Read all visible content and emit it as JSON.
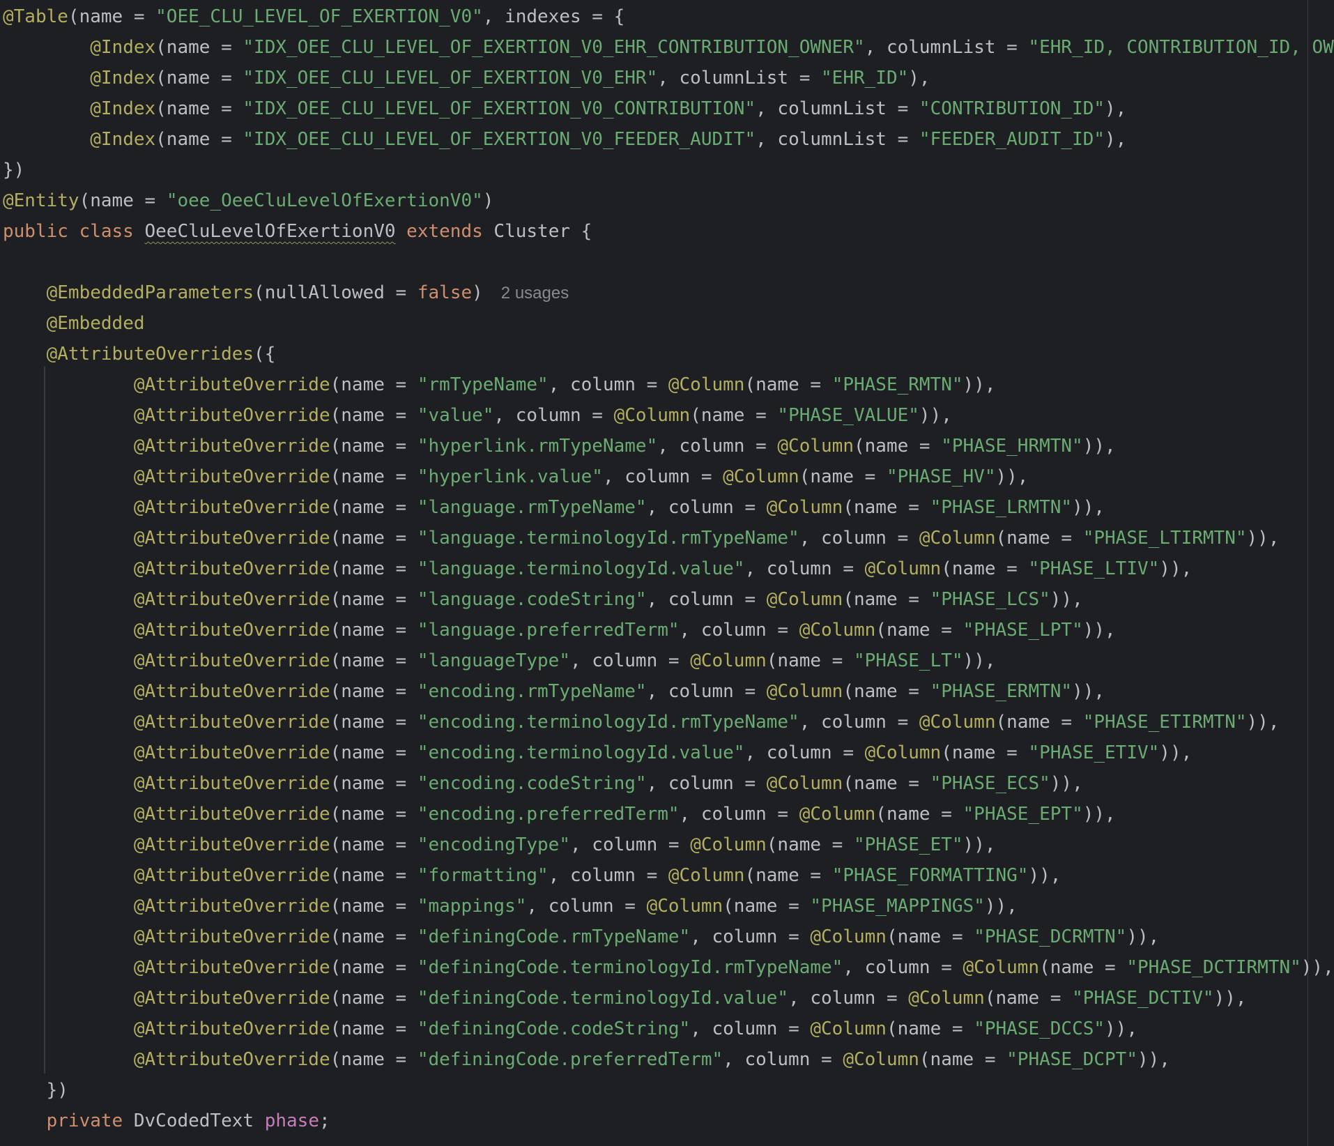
{
  "editor": {
    "language": "java",
    "colors": {
      "background": "#1e1f22",
      "plain": "#bcbec4",
      "annotation": "#b3ae60",
      "string": "#6aab73",
      "keyword": "#cf8e6d",
      "field": "#c77dbb",
      "inlay_hint": "#868a91"
    },
    "lines": [
      [
        [
          "ann",
          "@Table"
        ],
        [
          "p",
          "(name = "
        ],
        [
          "str",
          "\"OEE_CLU_LEVEL_OF_EXERTION_V0\""
        ],
        [
          "p",
          ", indexes = {"
        ]
      ],
      [
        [
          "p",
          "        "
        ],
        [
          "ann",
          "@Index"
        ],
        [
          "p",
          "(name = "
        ],
        [
          "str",
          "\"IDX_OEE_CLU_LEVEL_OF_EXERTION_V0_EHR_CONTRIBUTION_OWNER\""
        ],
        [
          "p",
          ", columnList = "
        ],
        [
          "str",
          "\"EHR_ID, CONTRIBUTION_ID, OWN"
        ]
      ],
      [
        [
          "p",
          "        "
        ],
        [
          "ann",
          "@Index"
        ],
        [
          "p",
          "(name = "
        ],
        [
          "str",
          "\"IDX_OEE_CLU_LEVEL_OF_EXERTION_V0_EHR\""
        ],
        [
          "p",
          ", columnList = "
        ],
        [
          "str",
          "\"EHR_ID\""
        ],
        [
          "p",
          "),"
        ]
      ],
      [
        [
          "p",
          "        "
        ],
        [
          "ann",
          "@Index"
        ],
        [
          "p",
          "(name = "
        ],
        [
          "str",
          "\"IDX_OEE_CLU_LEVEL_OF_EXERTION_V0_CONTRIBUTION\""
        ],
        [
          "p",
          ", columnList = "
        ],
        [
          "str",
          "\"CONTRIBUTION_ID\""
        ],
        [
          "p",
          "),"
        ]
      ],
      [
        [
          "p",
          "        "
        ],
        [
          "ann",
          "@Index"
        ],
        [
          "p",
          "(name = "
        ],
        [
          "str",
          "\"IDX_OEE_CLU_LEVEL_OF_EXERTION_V0_FEEDER_AUDIT\""
        ],
        [
          "p",
          ", columnList = "
        ],
        [
          "str",
          "\"FEEDER_AUDIT_ID\""
        ],
        [
          "p",
          "),"
        ]
      ],
      [
        [
          "p",
          "})"
        ]
      ],
      [
        [
          "ann",
          "@Entity"
        ],
        [
          "p",
          "(name = "
        ],
        [
          "str",
          "\"oee_OeeCluLevelOfExertionV0\""
        ],
        [
          "p",
          ")"
        ]
      ],
      [
        [
          "kw",
          "public class "
        ],
        [
          "cls",
          "OeeCluLevelOfExertionV0"
        ],
        [
          "kw",
          " extends "
        ],
        [
          "p",
          "Cluster {"
        ]
      ],
      [],
      [
        [
          "p",
          "    "
        ],
        [
          "ann",
          "@EmbeddedParameters"
        ],
        [
          "p",
          "(nullAllowed = "
        ],
        [
          "kw",
          "false"
        ],
        [
          "p",
          ")"
        ],
        [
          "hint",
          "2 usages"
        ]
      ],
      [
        [
          "p",
          "    "
        ],
        [
          "ann",
          "@Embedded"
        ]
      ],
      [
        [
          "p",
          "    "
        ],
        [
          "ann",
          "@AttributeOverrides"
        ],
        [
          "p",
          "({"
        ]
      ],
      [
        [
          "p",
          "            "
        ],
        [
          "ann",
          "@AttributeOverride"
        ],
        [
          "p",
          "(name = "
        ],
        [
          "str",
          "\"rmTypeName\""
        ],
        [
          "p",
          ", column = "
        ],
        [
          "ann",
          "@Column"
        ],
        [
          "p",
          "(name = "
        ],
        [
          "str",
          "\"PHASE_RMTN\""
        ],
        [
          "p",
          ")),"
        ]
      ],
      [
        [
          "p",
          "            "
        ],
        [
          "ann",
          "@AttributeOverride"
        ],
        [
          "p",
          "(name = "
        ],
        [
          "str",
          "\"value\""
        ],
        [
          "p",
          ", column = "
        ],
        [
          "ann",
          "@Column"
        ],
        [
          "p",
          "(name = "
        ],
        [
          "str",
          "\"PHASE_VALUE\""
        ],
        [
          "p",
          ")),"
        ]
      ],
      [
        [
          "p",
          "            "
        ],
        [
          "ann",
          "@AttributeOverride"
        ],
        [
          "p",
          "(name = "
        ],
        [
          "str",
          "\"hyperlink.rmTypeName\""
        ],
        [
          "p",
          ", column = "
        ],
        [
          "ann",
          "@Column"
        ],
        [
          "p",
          "(name = "
        ],
        [
          "str",
          "\"PHASE_HRMTN\""
        ],
        [
          "p",
          ")),"
        ]
      ],
      [
        [
          "p",
          "            "
        ],
        [
          "ann",
          "@AttributeOverride"
        ],
        [
          "p",
          "(name = "
        ],
        [
          "str",
          "\"hyperlink.value\""
        ],
        [
          "p",
          ", column = "
        ],
        [
          "ann",
          "@Column"
        ],
        [
          "p",
          "(name = "
        ],
        [
          "str",
          "\"PHASE_HV\""
        ],
        [
          "p",
          ")),"
        ]
      ],
      [
        [
          "p",
          "            "
        ],
        [
          "ann",
          "@AttributeOverride"
        ],
        [
          "p",
          "(name = "
        ],
        [
          "str",
          "\"language.rmTypeName\""
        ],
        [
          "p",
          ", column = "
        ],
        [
          "ann",
          "@Column"
        ],
        [
          "p",
          "(name = "
        ],
        [
          "str",
          "\"PHASE_LRMTN\""
        ],
        [
          "p",
          ")),"
        ]
      ],
      [
        [
          "p",
          "            "
        ],
        [
          "ann",
          "@AttributeOverride"
        ],
        [
          "p",
          "(name = "
        ],
        [
          "str",
          "\"language.terminologyId.rmTypeName\""
        ],
        [
          "p",
          ", column = "
        ],
        [
          "ann",
          "@Column"
        ],
        [
          "p",
          "(name = "
        ],
        [
          "str",
          "\"PHASE_LTIRMTN\""
        ],
        [
          "p",
          ")),"
        ]
      ],
      [
        [
          "p",
          "            "
        ],
        [
          "ann",
          "@AttributeOverride"
        ],
        [
          "p",
          "(name = "
        ],
        [
          "str",
          "\"language.terminologyId.value\""
        ],
        [
          "p",
          ", column = "
        ],
        [
          "ann",
          "@Column"
        ],
        [
          "p",
          "(name = "
        ],
        [
          "str",
          "\"PHASE_LTIV\""
        ],
        [
          "p",
          ")),"
        ]
      ],
      [
        [
          "p",
          "            "
        ],
        [
          "ann",
          "@AttributeOverride"
        ],
        [
          "p",
          "(name = "
        ],
        [
          "str",
          "\"language.codeString\""
        ],
        [
          "p",
          ", column = "
        ],
        [
          "ann",
          "@Column"
        ],
        [
          "p",
          "(name = "
        ],
        [
          "str",
          "\"PHASE_LCS\""
        ],
        [
          "p",
          ")),"
        ]
      ],
      [
        [
          "p",
          "            "
        ],
        [
          "ann",
          "@AttributeOverride"
        ],
        [
          "p",
          "(name = "
        ],
        [
          "str",
          "\"language.preferredTerm\""
        ],
        [
          "p",
          ", column = "
        ],
        [
          "ann",
          "@Column"
        ],
        [
          "p",
          "(name = "
        ],
        [
          "str",
          "\"PHASE_LPT\""
        ],
        [
          "p",
          ")),"
        ]
      ],
      [
        [
          "p",
          "            "
        ],
        [
          "ann",
          "@AttributeOverride"
        ],
        [
          "p",
          "(name = "
        ],
        [
          "str",
          "\"languageType\""
        ],
        [
          "p",
          ", column = "
        ],
        [
          "ann",
          "@Column"
        ],
        [
          "p",
          "(name = "
        ],
        [
          "str",
          "\"PHASE_LT\""
        ],
        [
          "p",
          ")),"
        ]
      ],
      [
        [
          "p",
          "            "
        ],
        [
          "ann",
          "@AttributeOverride"
        ],
        [
          "p",
          "(name = "
        ],
        [
          "str",
          "\"encoding.rmTypeName\""
        ],
        [
          "p",
          ", column = "
        ],
        [
          "ann",
          "@Column"
        ],
        [
          "p",
          "(name = "
        ],
        [
          "str",
          "\"PHASE_ERMTN\""
        ],
        [
          "p",
          ")),"
        ]
      ],
      [
        [
          "p",
          "            "
        ],
        [
          "ann",
          "@AttributeOverride"
        ],
        [
          "p",
          "(name = "
        ],
        [
          "str",
          "\"encoding.terminologyId.rmTypeName\""
        ],
        [
          "p",
          ", column = "
        ],
        [
          "ann",
          "@Column"
        ],
        [
          "p",
          "(name = "
        ],
        [
          "str",
          "\"PHASE_ETIRMTN\""
        ],
        [
          "p",
          ")),"
        ]
      ],
      [
        [
          "p",
          "            "
        ],
        [
          "ann",
          "@AttributeOverride"
        ],
        [
          "p",
          "(name = "
        ],
        [
          "str",
          "\"encoding.terminologyId.value\""
        ],
        [
          "p",
          ", column = "
        ],
        [
          "ann",
          "@Column"
        ],
        [
          "p",
          "(name = "
        ],
        [
          "str",
          "\"PHASE_ETIV\""
        ],
        [
          "p",
          ")),"
        ]
      ],
      [
        [
          "p",
          "            "
        ],
        [
          "ann",
          "@AttributeOverride"
        ],
        [
          "p",
          "(name = "
        ],
        [
          "str",
          "\"encoding.codeString\""
        ],
        [
          "p",
          ", column = "
        ],
        [
          "ann",
          "@Column"
        ],
        [
          "p",
          "(name = "
        ],
        [
          "str",
          "\"PHASE_ECS\""
        ],
        [
          "p",
          ")),"
        ]
      ],
      [
        [
          "p",
          "            "
        ],
        [
          "ann",
          "@AttributeOverride"
        ],
        [
          "p",
          "(name = "
        ],
        [
          "str",
          "\"encoding.preferredTerm\""
        ],
        [
          "p",
          ", column = "
        ],
        [
          "ann",
          "@Column"
        ],
        [
          "p",
          "(name = "
        ],
        [
          "str",
          "\"PHASE_EPT\""
        ],
        [
          "p",
          ")),"
        ]
      ],
      [
        [
          "p",
          "            "
        ],
        [
          "ann",
          "@AttributeOverride"
        ],
        [
          "p",
          "(name = "
        ],
        [
          "str",
          "\"encodingType\""
        ],
        [
          "p",
          ", column = "
        ],
        [
          "ann",
          "@Column"
        ],
        [
          "p",
          "(name = "
        ],
        [
          "str",
          "\"PHASE_ET\""
        ],
        [
          "p",
          ")),"
        ]
      ],
      [
        [
          "p",
          "            "
        ],
        [
          "ann",
          "@AttributeOverride"
        ],
        [
          "p",
          "(name = "
        ],
        [
          "str",
          "\"formatting\""
        ],
        [
          "p",
          ", column = "
        ],
        [
          "ann",
          "@Column"
        ],
        [
          "p",
          "(name = "
        ],
        [
          "str",
          "\"PHASE_FORMATTING\""
        ],
        [
          "p",
          ")),"
        ]
      ],
      [
        [
          "p",
          "            "
        ],
        [
          "ann",
          "@AttributeOverride"
        ],
        [
          "p",
          "(name = "
        ],
        [
          "str",
          "\"mappings\""
        ],
        [
          "p",
          ", column = "
        ],
        [
          "ann",
          "@Column"
        ],
        [
          "p",
          "(name = "
        ],
        [
          "str",
          "\"PHASE_MAPPINGS\""
        ],
        [
          "p",
          ")),"
        ]
      ],
      [
        [
          "p",
          "            "
        ],
        [
          "ann",
          "@AttributeOverride"
        ],
        [
          "p",
          "(name = "
        ],
        [
          "str",
          "\"definingCode.rmTypeName\""
        ],
        [
          "p",
          ", column = "
        ],
        [
          "ann",
          "@Column"
        ],
        [
          "p",
          "(name = "
        ],
        [
          "str",
          "\"PHASE_DCRMTN\""
        ],
        [
          "p",
          ")),"
        ]
      ],
      [
        [
          "p",
          "            "
        ],
        [
          "ann",
          "@AttributeOverride"
        ],
        [
          "p",
          "(name = "
        ],
        [
          "str",
          "\"definingCode.terminologyId.rmTypeName\""
        ],
        [
          "p",
          ", column = "
        ],
        [
          "ann",
          "@Column"
        ],
        [
          "p",
          "(name = "
        ],
        [
          "str",
          "\"PHASE_DCTIRMTN\""
        ],
        [
          "p",
          ")),"
        ]
      ],
      [
        [
          "p",
          "            "
        ],
        [
          "ann",
          "@AttributeOverride"
        ],
        [
          "p",
          "(name = "
        ],
        [
          "str",
          "\"definingCode.terminologyId.value\""
        ],
        [
          "p",
          ", column = "
        ],
        [
          "ann",
          "@Column"
        ],
        [
          "p",
          "(name = "
        ],
        [
          "str",
          "\"PHASE_DCTIV\""
        ],
        [
          "p",
          ")),"
        ]
      ],
      [
        [
          "p",
          "            "
        ],
        [
          "ann",
          "@AttributeOverride"
        ],
        [
          "p",
          "(name = "
        ],
        [
          "str",
          "\"definingCode.codeString\""
        ],
        [
          "p",
          ", column = "
        ],
        [
          "ann",
          "@Column"
        ],
        [
          "p",
          "(name = "
        ],
        [
          "str",
          "\"PHASE_DCCS\""
        ],
        [
          "p",
          ")),"
        ]
      ],
      [
        [
          "p",
          "            "
        ],
        [
          "ann",
          "@AttributeOverride"
        ],
        [
          "p",
          "(name = "
        ],
        [
          "str",
          "\"definingCode.preferredTerm\""
        ],
        [
          "p",
          ", column = "
        ],
        [
          "ann",
          "@Column"
        ],
        [
          "p",
          "(name = "
        ],
        [
          "str",
          "\"PHASE_DCPT\""
        ],
        [
          "p",
          ")),"
        ]
      ],
      [
        [
          "p",
          "    })"
        ]
      ],
      [
        [
          "p",
          "    "
        ],
        [
          "kw",
          "private "
        ],
        [
          "p",
          "DvCodedText "
        ],
        [
          "field",
          "phase"
        ],
        [
          "p",
          ";"
        ]
      ]
    ]
  }
}
